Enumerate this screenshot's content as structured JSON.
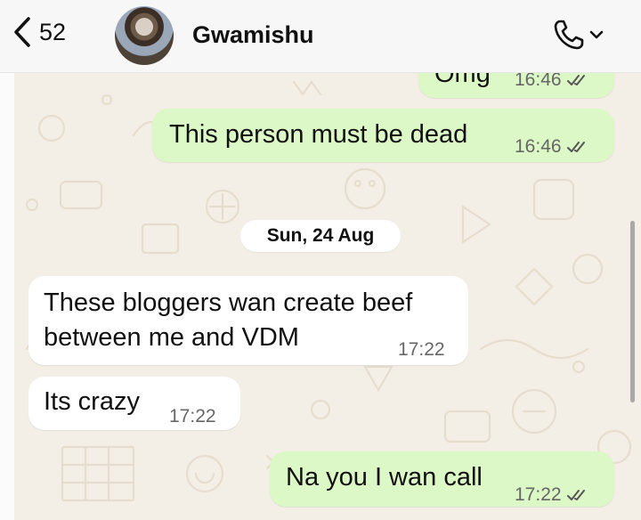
{
  "header": {
    "back_count": "52",
    "contact_name": "Gwamishu"
  },
  "chat": {
    "date_separator": "Sun, 24 Aug",
    "messages": [
      {
        "text": "Omg",
        "time": "16:46",
        "direction": "outgoing",
        "status": "read"
      },
      {
        "text": "This person must be dead",
        "time": "16:46",
        "direction": "outgoing",
        "status": "read"
      },
      {
        "line1": "These bloggers wan create beef",
        "line2": "between me and VDM",
        "time": "17:22",
        "direction": "incoming"
      },
      {
        "text": "Its crazy",
        "time": "17:22",
        "direction": "incoming"
      },
      {
        "text": "Na you I wan call",
        "time": "17:22",
        "direction": "outgoing",
        "status": "read"
      }
    ]
  },
  "colors": {
    "outgoing_bubble": "#dcf8c6",
    "incoming_bubble": "#ffffff",
    "wallpaper": "#f4efe6",
    "read_ticks": "#555555"
  },
  "icons": [
    "chevron-left-icon",
    "phone-icon",
    "chevron-down-icon",
    "double-check-icon"
  ]
}
